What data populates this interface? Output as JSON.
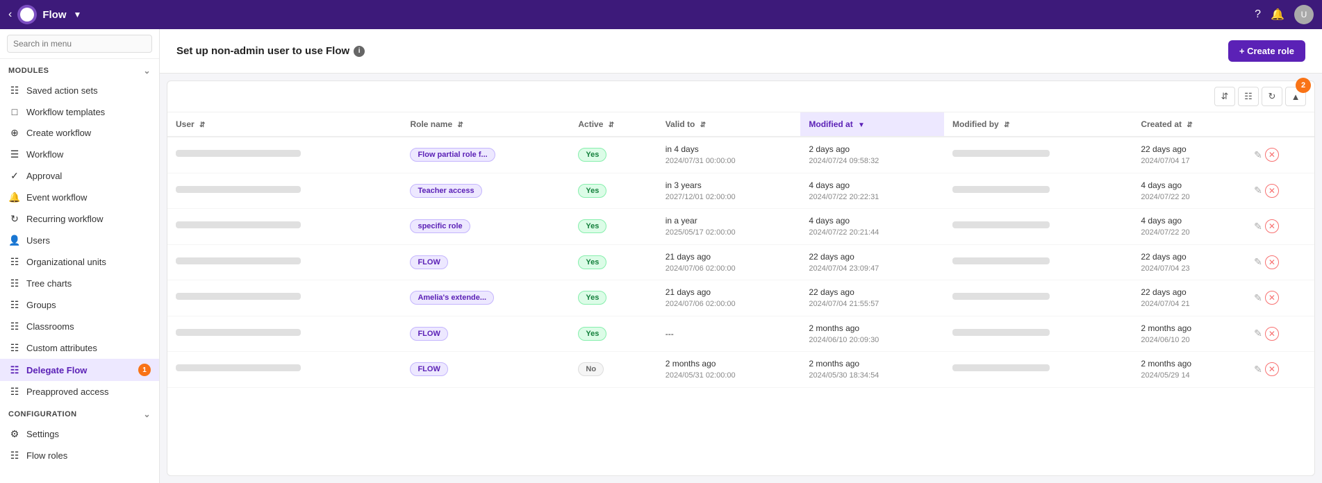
{
  "topbar": {
    "back_label": "‹",
    "logo_alt": "Flow logo",
    "title": "Flow",
    "chevron": "▾",
    "help_icon": "?",
    "bell_icon": "🔔",
    "avatar_label": "U"
  },
  "sidebar": {
    "search_placeholder": "Search in menu",
    "modules_label": "MODULES",
    "configuration_label": "CONFIGURATION",
    "items": [
      {
        "id": "saved-action-sets",
        "label": "Saved action sets",
        "icon": "⊞"
      },
      {
        "id": "workflow-templates",
        "label": "Workflow templates",
        "icon": "⊡"
      },
      {
        "id": "create-workflow",
        "label": "Create workflow",
        "icon": "⊕"
      },
      {
        "id": "workflow",
        "label": "Workflow",
        "icon": "☰"
      },
      {
        "id": "approval",
        "label": "Approval",
        "icon": "✓"
      },
      {
        "id": "event-workflow",
        "label": "Event workflow",
        "icon": "🔔"
      },
      {
        "id": "recurring-workflow",
        "label": "Recurring workflow",
        "icon": "↻"
      },
      {
        "id": "users",
        "label": "Users",
        "icon": "👤"
      },
      {
        "id": "organizational-units",
        "label": "Organizational units",
        "icon": "⊞"
      },
      {
        "id": "tree-charts",
        "label": "Tree charts",
        "icon": "⊞"
      },
      {
        "id": "groups",
        "label": "Groups",
        "icon": "⊞"
      },
      {
        "id": "classrooms",
        "label": "Classrooms",
        "icon": "⊞"
      },
      {
        "id": "custom-attributes",
        "label": "Custom attributes",
        "icon": "⊞"
      },
      {
        "id": "delegate-flow",
        "label": "Delegate Flow",
        "icon": "⊞",
        "active": true,
        "badge": "1"
      },
      {
        "id": "preapproved-access",
        "label": "Preapproved access",
        "icon": "⊞"
      }
    ],
    "config_items": [
      {
        "id": "settings",
        "label": "Settings",
        "icon": "⚙"
      },
      {
        "id": "flow-roles",
        "label": "Flow roles",
        "icon": "⊞"
      }
    ]
  },
  "content": {
    "header_title": "Set up non-admin user to use Flow",
    "create_role_btn": "+ Create role",
    "notification_count": "2",
    "table": {
      "columns": [
        {
          "id": "user",
          "label": "User",
          "sortable": true
        },
        {
          "id": "role-name",
          "label": "Role name",
          "sortable": true
        },
        {
          "id": "active",
          "label": "Active",
          "sortable": true
        },
        {
          "id": "valid-to",
          "label": "Valid to",
          "sortable": true
        },
        {
          "id": "modified-at",
          "label": "Modified at",
          "sortable": true,
          "sorted": true
        },
        {
          "id": "modified-by",
          "label": "Modified by",
          "sortable": true
        },
        {
          "id": "created-at",
          "label": "Created at",
          "sortable": true
        }
      ],
      "rows": [
        {
          "user": "blurred",
          "role_name": "Flow partial role f...",
          "active": "Yes",
          "valid_to_rel": "in 4 days",
          "valid_to_abs": "2024/07/31 00:00:00",
          "modified_at_rel": "2 days ago",
          "modified_at_abs": "2024/07/24 09:58:32",
          "modified_by": "blurred",
          "created_at_rel": "22 days ago",
          "created_at_abs": "2024/07/04 17"
        },
        {
          "user": "blurred",
          "role_name": "Teacher access",
          "active": "Yes",
          "valid_to_rel": "in 3 years",
          "valid_to_abs": "2027/12/01 02:00:00",
          "modified_at_rel": "4 days ago",
          "modified_at_abs": "2024/07/22 20:22:31",
          "modified_by": "blurred",
          "created_at_rel": "4 days ago",
          "created_at_abs": "2024/07/22 20"
        },
        {
          "user": "blurred",
          "role_name": "specific role",
          "active": "Yes",
          "valid_to_rel": "in a year",
          "valid_to_abs": "2025/05/17 02:00:00",
          "modified_at_rel": "4 days ago",
          "modified_at_abs": "2024/07/22 20:21:44",
          "modified_by": "blurred",
          "created_at_rel": "4 days ago",
          "created_at_abs": "2024/07/22 20"
        },
        {
          "user": "blurred",
          "role_name": "FLOW",
          "active": "Yes",
          "valid_to_rel": "21 days ago",
          "valid_to_abs": "2024/07/06 02:00:00",
          "modified_at_rel": "22 days ago",
          "modified_at_abs": "2024/07/04 23:09:47",
          "modified_by": "blurred",
          "created_at_rel": "22 days ago",
          "created_at_abs": "2024/07/04 23"
        },
        {
          "user": "blurred",
          "role_name": "Amelia's extende...",
          "active": "Yes",
          "valid_to_rel": "21 days ago",
          "valid_to_abs": "2024/07/06 02:00:00",
          "modified_at_rel": "22 days ago",
          "modified_at_abs": "2024/07/04 21:55:57",
          "modified_by": "blurred",
          "created_at_rel": "22 days ago",
          "created_at_abs": "2024/07/04 21"
        },
        {
          "user": "blurred",
          "role_name": "FLOW",
          "active": "Yes",
          "valid_to_rel": "---",
          "valid_to_abs": "",
          "modified_at_rel": "2 months ago",
          "modified_at_abs": "2024/06/10 20:09:30",
          "modified_by": "blurred",
          "created_at_rel": "2 months ago",
          "created_at_abs": "2024/06/10 20"
        },
        {
          "user": "blurred",
          "role_name": "FLOW",
          "active": "No",
          "valid_to_rel": "2 months ago",
          "valid_to_abs": "2024/05/31 02:00:00",
          "modified_at_rel": "2 months ago",
          "modified_at_abs": "2024/05/30 18:34:54",
          "modified_by": "blurred",
          "created_at_rel": "2 months ago",
          "created_at_abs": "2024/05/29 14"
        }
      ]
    }
  }
}
